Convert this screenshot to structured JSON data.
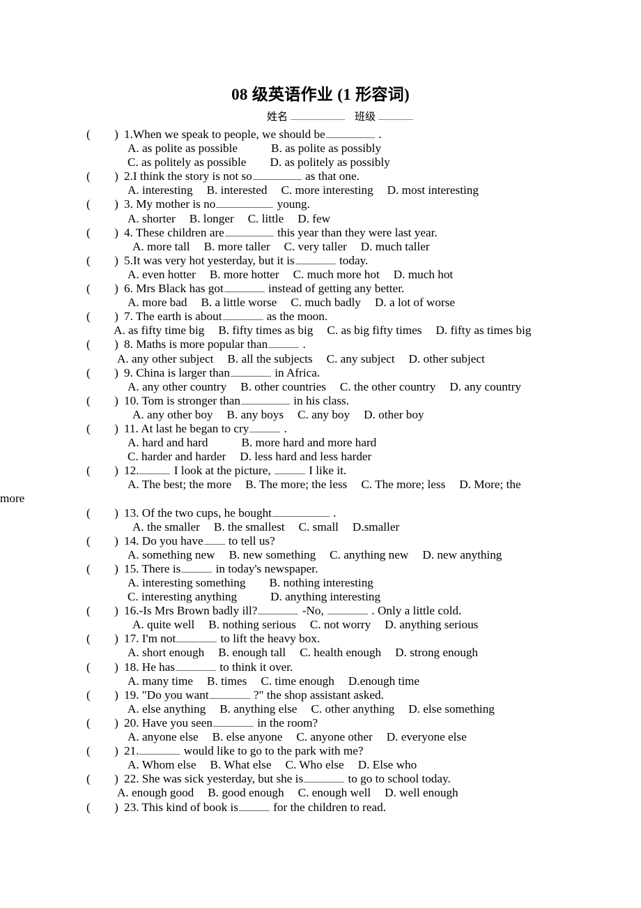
{
  "document": {
    "title": "08 级英语作业 (1 形容词)",
    "name_label": "姓名",
    "class_label": "班级"
  },
  "questions": [
    {
      "marker": "(        )",
      "stem_pre": "1.When we speak to people, we should be",
      "stem_post": ".",
      "blank": "b-l",
      "option_lines": [
        {
          "indent": "opt",
          "text_a": "A. as polite as possible",
          "gap": "sp-xl",
          "text_b": "B. as polite as possibly"
        },
        {
          "indent": "opt",
          "text_a": "C. as politely as possible",
          "gap": "sp-l",
          "text_b": "D. as politely as possibly"
        }
      ]
    },
    {
      "marker": "(        )",
      "stem_pre": "2.I think the story is not so",
      "stem_post": "as that one.",
      "blank": "b-l",
      "option_lines": [
        {
          "indent": "opt",
          "parts": [
            "A. interesting",
            "B. interested",
            "C. more interesting",
            "D. most interesting"
          ]
        }
      ]
    },
    {
      "marker": "(        )",
      "stem_pre": "3. My mother is no",
      "stem_post": "young.",
      "blank": "b-xl",
      "option_lines": [
        {
          "indent": "opt",
          "parts": [
            "A. shorter",
            "B. longer",
            "C. little",
            "D. few"
          ]
        }
      ]
    },
    {
      "marker": "(        )",
      "stem_pre": "4. These children are",
      "stem_post": "this year than they were last year.",
      "blank": "b-l",
      "option_lines": [
        {
          "indent": "opt-in",
          "parts": [
            "A. more tall",
            "B. more taller",
            "C. very taller",
            "D. much taller"
          ]
        }
      ]
    },
    {
      "marker": "(        )",
      "stem_pre": "5.It was very hot yesterday, but it is",
      "stem_post": "today.",
      "blank": "b-m",
      "option_lines": [
        {
          "indent": "opt",
          "parts": [
            "A. even hotter",
            "B. more hotter",
            "C. much more hot",
            "D. much hot"
          ]
        }
      ]
    },
    {
      "marker": "(        )",
      "stem_pre": "6. Mrs Black has got",
      "stem_post": "instead of getting any better.",
      "blank": "b-m",
      "option_lines": [
        {
          "indent": "opt",
          "parts": [
            "A. more bad",
            "B. a little worse",
            "C. much badly",
            "D. a lot of worse"
          ]
        }
      ]
    },
    {
      "marker": "(        )",
      "stem_pre": "7. The earth is about",
      "stem_post": "as the moon.",
      "blank": "b-m",
      "option_lines": [
        {
          "indent": "opt-out",
          "parts": [
            "A. as fifty time big",
            "B. fifty times as big",
            "C. as big fifty times",
            "D. fifty as times big"
          ]
        }
      ]
    },
    {
      "marker": "(        )",
      "stem_pre": "8. Maths is more popular than",
      "stem_post": ".",
      "blank": "b-s",
      "option_lines": [
        {
          "indent": "opt-out2",
          "parts": [
            "A. any other subject",
            "B. all the subjects",
            "C. any subject",
            "D. other subject"
          ]
        }
      ]
    },
    {
      "marker": "(        )",
      "stem_pre": "9. China is larger than",
      "stem_post": "in Africa.",
      "blank": "b-m",
      "option_lines": [
        {
          "indent": "opt",
          "parts": [
            "A. any other country",
            "B. other countries",
            "C. the other country",
            "D. any country"
          ]
        }
      ]
    },
    {
      "marker": "(        )",
      "stem_pre": "10. Tom is stronger than",
      "stem_post": "in his class.",
      "blank": "b-l",
      "option_lines": [
        {
          "indent": "opt-in",
          "parts": [
            "A. any other boy",
            "B. any boys",
            "C. any boy",
            "D. other boy"
          ]
        }
      ]
    },
    {
      "marker": "(        )",
      "stem_pre": "11. At last he began to cry",
      "stem_post": ".",
      "blank": "b-s",
      "option_lines": [
        {
          "indent": "opt",
          "text_a": "A. hard and hard",
          "gap": "sp-xl",
          "text_b": "B. more hard and more hard"
        },
        {
          "indent": "opt",
          "text_a": "C. harder and harder",
          "gap": "sp-m",
          "text_b": "D. less hard and less harder"
        }
      ]
    },
    {
      "marker": "(        )",
      "stem_pre": "12.",
      "stem_mid": "I look at the picture,",
      "stem_post": "I like it.",
      "blank": "b-s",
      "blank2": "b-s",
      "option_lines": [
        {
          "indent": "opt",
          "parts": [
            "A. The best; the more",
            "B. The more; the less",
            "C. The more; less",
            "D. More; the"
          ]
        }
      ],
      "wrap_text": "more"
    },
    {
      "marker": "(        )",
      "stem_pre": "13. Of the two cups, he bought",
      "stem_post": ".",
      "blank": "b-xl",
      "option_lines": [
        {
          "indent": "opt-in",
          "parts": [
            "A. the smaller",
            "B. the smallest",
            "C. small",
            "D.smaller"
          ]
        }
      ]
    },
    {
      "marker": "(        )",
      "stem_pre": "14. Do you have",
      "stem_post": "to tell us?",
      "blank": "b-xs",
      "option_lines": [
        {
          "indent": "opt",
          "parts": [
            "A. something new",
            "B. new something",
            "C. anything new",
            "D. new anything"
          ]
        }
      ]
    },
    {
      "marker": "(        )",
      "stem_pre": "15. There is",
      "stem_post": "in today's newspaper.",
      "blank": "b-s",
      "option_lines": [
        {
          "indent": "opt",
          "text_a": "A. interesting something",
          "gap": "sp-l",
          "text_b": "B. nothing interesting"
        },
        {
          "indent": "opt",
          "text_a": "C. interesting anything",
          "gap": "sp-xl",
          "text_b": "D. anything interesting"
        }
      ]
    },
    {
      "marker": "(        )",
      "stem_pre": "16.-Is Mrs Brown badly ill?",
      "stem_mid": "-No,",
      "stem_post": ". Only a little cold.",
      "blank": "b-m",
      "option_lines": [
        {
          "indent": "opt-in",
          "parts": [
            "A. quite well",
            "B. nothing serious",
            "C. not worry",
            "D. anything serious"
          ]
        }
      ]
    },
    {
      "marker": "(        )",
      "stem_pre": "17. I'm not",
      "stem_post": "to lift the heavy box.",
      "blank": "b-m",
      "option_lines": [
        {
          "indent": "opt",
          "parts": [
            "A. short enough",
            "B. enough tall",
            "C. health enough",
            "D. strong enough"
          ]
        }
      ]
    },
    {
      "marker": "(        )",
      "stem_pre": "18. He has",
      "stem_post": "to think it over.",
      "blank": "b-m",
      "option_lines": [
        {
          "indent": "opt",
          "parts": [
            "A. many time",
            "B. times",
            "C. time enough",
            "D.enough time"
          ]
        }
      ]
    },
    {
      "marker": "(        )",
      "stem_pre": "19. \"Do you want",
      "stem_post": "?\" the shop assistant asked.",
      "blank": "b-m",
      "option_lines": [
        {
          "indent": "opt",
          "parts": [
            "A. else anything",
            "B. anything else",
            "C. other anything",
            "D. else something"
          ]
        }
      ]
    },
    {
      "marker": "(        )",
      "stem_pre": "20. Have you seen",
      "stem_post": "in the room?",
      "blank": "b-m",
      "option_lines": [
        {
          "indent": "opt",
          "parts": [
            "A. anyone else",
            "B. else anyone",
            "C. anyone other",
            "D. everyone else"
          ]
        }
      ]
    },
    {
      "marker": "(        )",
      "stem_pre": "21.",
      "stem_post": "would like to go to the park with me?",
      "blank": "b-m",
      "option_lines": [
        {
          "indent": "opt",
          "parts": [
            "A. Whom else",
            "B. What else",
            "C. Who else",
            "D. Else who"
          ]
        }
      ]
    },
    {
      "marker": "(        )",
      "stem_pre": "22. She was sick yesterday, but she is",
      "stem_post": "to go to school today.",
      "blank": "b-m",
      "option_lines": [
        {
          "indent": "opt-out2",
          "parts": [
            "A. enough good",
            "B. good enough",
            "C. enough well",
            "D. well enough"
          ]
        }
      ]
    },
    {
      "marker": "(        )",
      "stem_pre": "23. This kind of book is",
      "stem_post": "for the children to read.",
      "blank": "b-s",
      "option_lines": []
    }
  ]
}
